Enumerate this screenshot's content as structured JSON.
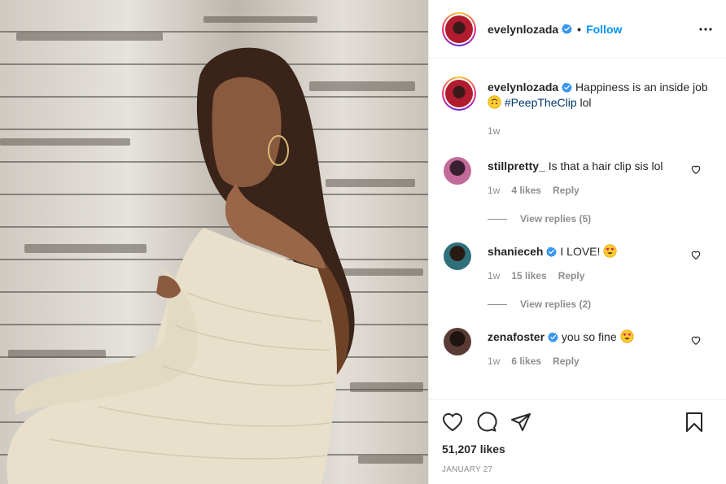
{
  "post": {
    "author": {
      "username": "evelynlozada",
      "verified_icon": "verified-badge-icon",
      "follow_label": "Follow",
      "separator": "•"
    },
    "caption": {
      "username": "evelynlozada",
      "text_before": "Happiness is an inside job",
      "emoji_name": "upside-down-face-emoji",
      "hashtag": "#PeepTheClip",
      "text_after": "lol",
      "time": "1w"
    },
    "comments": [
      {
        "username": "stillpretty_",
        "verified": false,
        "text": "Is that a hair clip sis lol",
        "time": "1w",
        "likes": "4 likes",
        "reply_label": "Reply",
        "view_replies": "View replies (5)",
        "avatar_color": "#c26b9a"
      },
      {
        "username": "shanieceh",
        "verified": true,
        "text": "I LOVE!",
        "emoji_name": "heart-eyes-emoji",
        "time": "1w",
        "likes": "15 likes",
        "reply_label": "Reply",
        "view_replies": "View replies (2)",
        "avatar_color": "#2f6f7a"
      },
      {
        "username": "zenafoster",
        "verified": true,
        "text": "you so fine",
        "emoji_name": "heart-eyes-emoji",
        "time": "1w",
        "likes": "6 likes",
        "reply_label": "Reply",
        "avatar_color": "#5a3a34"
      }
    ],
    "likes": "51,207 likes",
    "date": "JANUARY 27",
    "colors": {
      "accent": "#0095f6",
      "hashtag": "#00376b",
      "muted": "#8e8e8e",
      "text": "#262626"
    },
    "icons": [
      "more-options-icon",
      "like-heart-icon",
      "comment-icon",
      "share-icon",
      "bookmark-icon"
    ]
  }
}
